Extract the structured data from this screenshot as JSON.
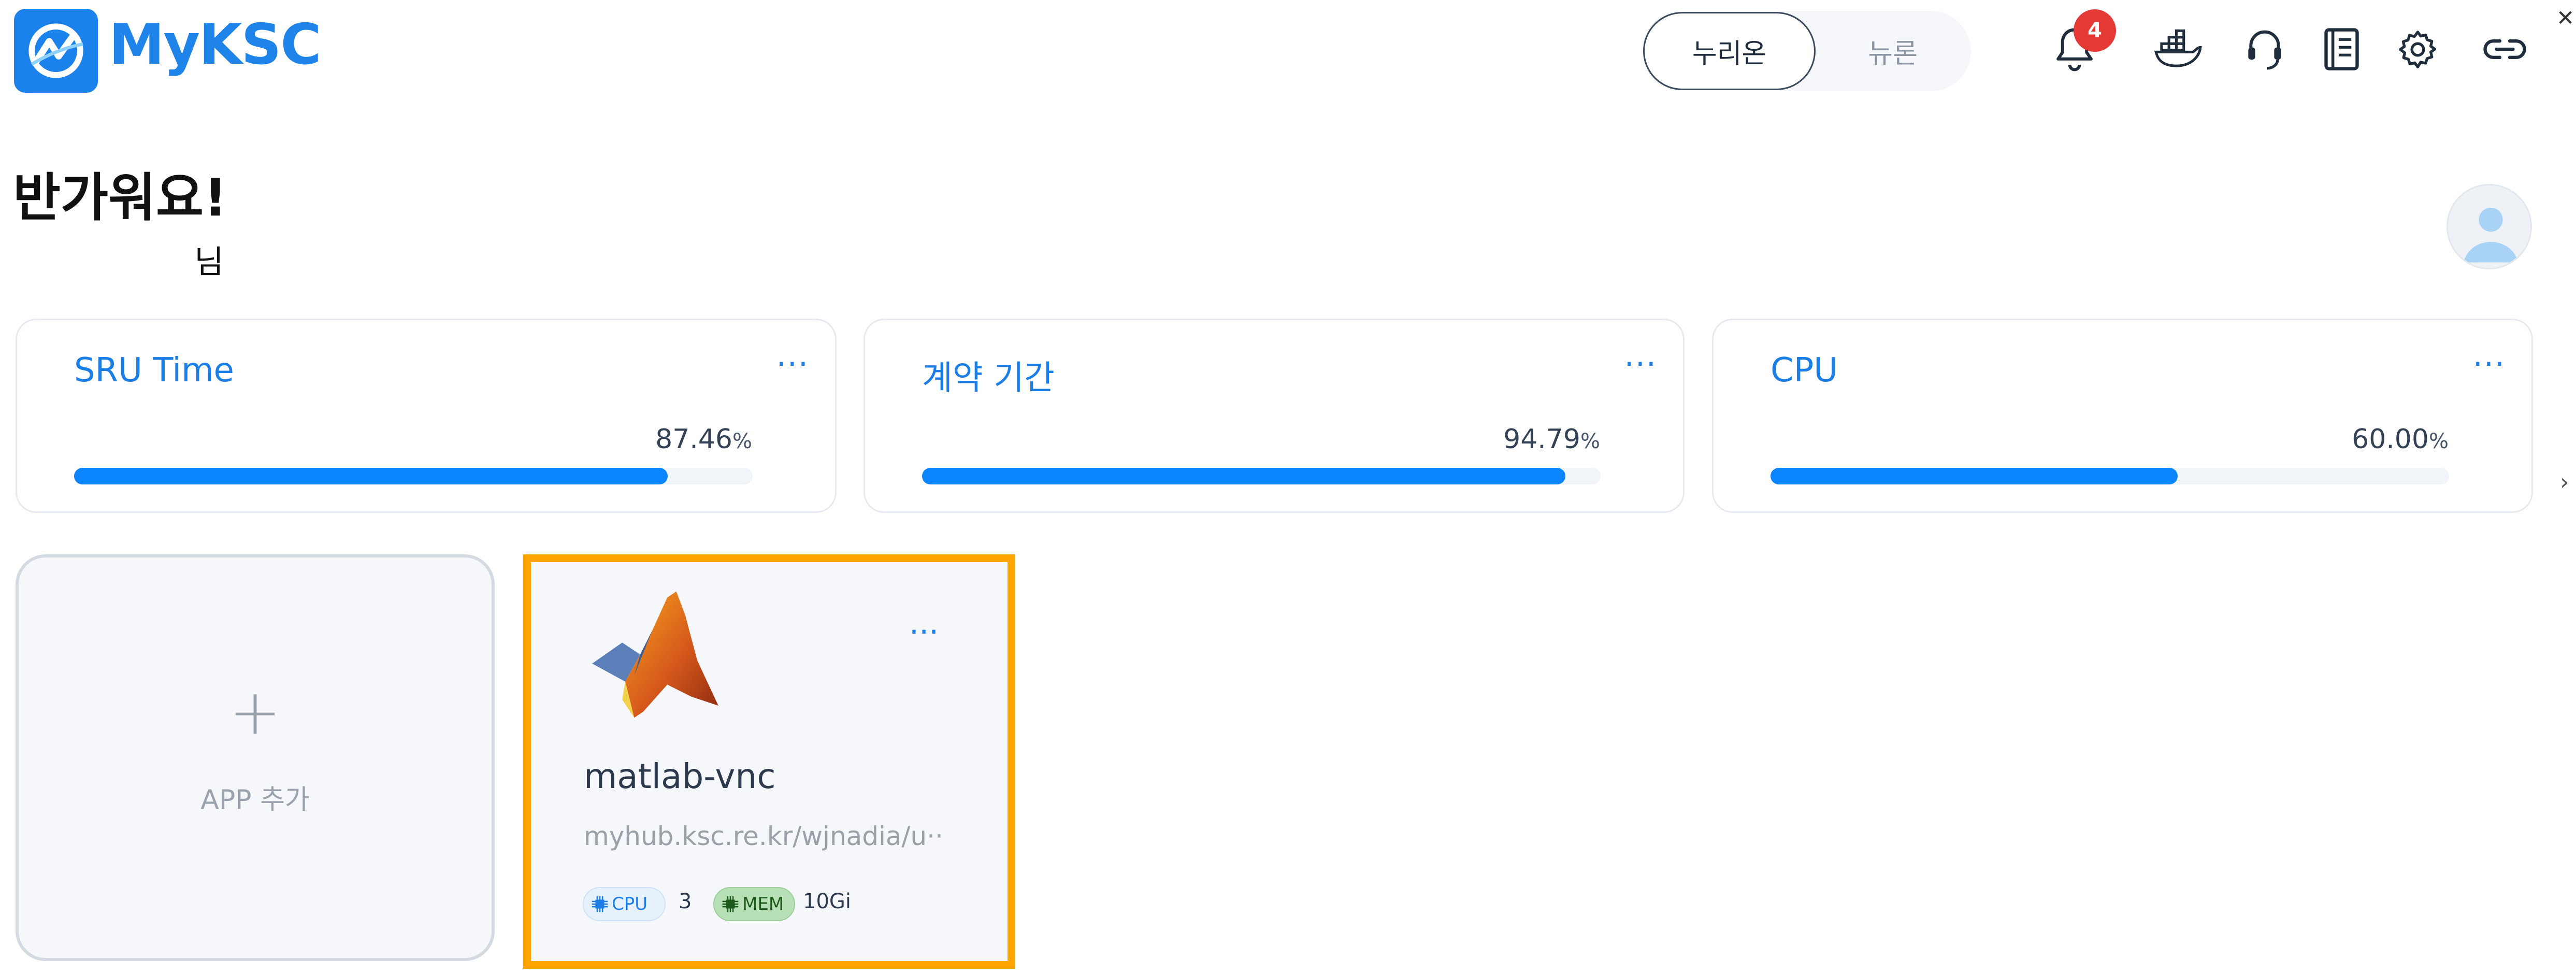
{
  "header": {
    "brand": "MyKSC",
    "toggle": {
      "active": "누리온",
      "inactive": "뉴론"
    },
    "notifications_count": "4",
    "icons": [
      "bell-icon",
      "docker-icon",
      "headset-icon",
      "notebook-icon",
      "gear-icon",
      "link-icon",
      "close-icon"
    ]
  },
  "greeting": {
    "title": "반가워요!",
    "subtitle": "님"
  },
  "stats": [
    {
      "title": "SRU Time",
      "value": "87.46",
      "unit": "%",
      "fraction": 0.8746,
      "menu": "···"
    },
    {
      "title": "계약 기간",
      "value": "94.79",
      "unit": "%",
      "fraction": 0.9479,
      "menu": "···"
    },
    {
      "title": "CPU",
      "value": "60.00",
      "unit": "%",
      "fraction": 0.6,
      "menu": "···"
    }
  ],
  "apps": {
    "add_label": "APP 추가",
    "add_symbol": "+",
    "items": [
      {
        "name": "matlab-vnc",
        "url": "myhub.ksc.re.kr/wjnadia/u···",
        "menu": "···",
        "cpu_label": "CPU",
        "cpu_value": "3",
        "mem_label": "MEM",
        "mem_value": "10Gi"
      }
    ]
  },
  "colors": {
    "accent": "#1a82ea",
    "progress": "#0a84ff",
    "badge": "#e53935",
    "selected_border": "#ffa500"
  }
}
